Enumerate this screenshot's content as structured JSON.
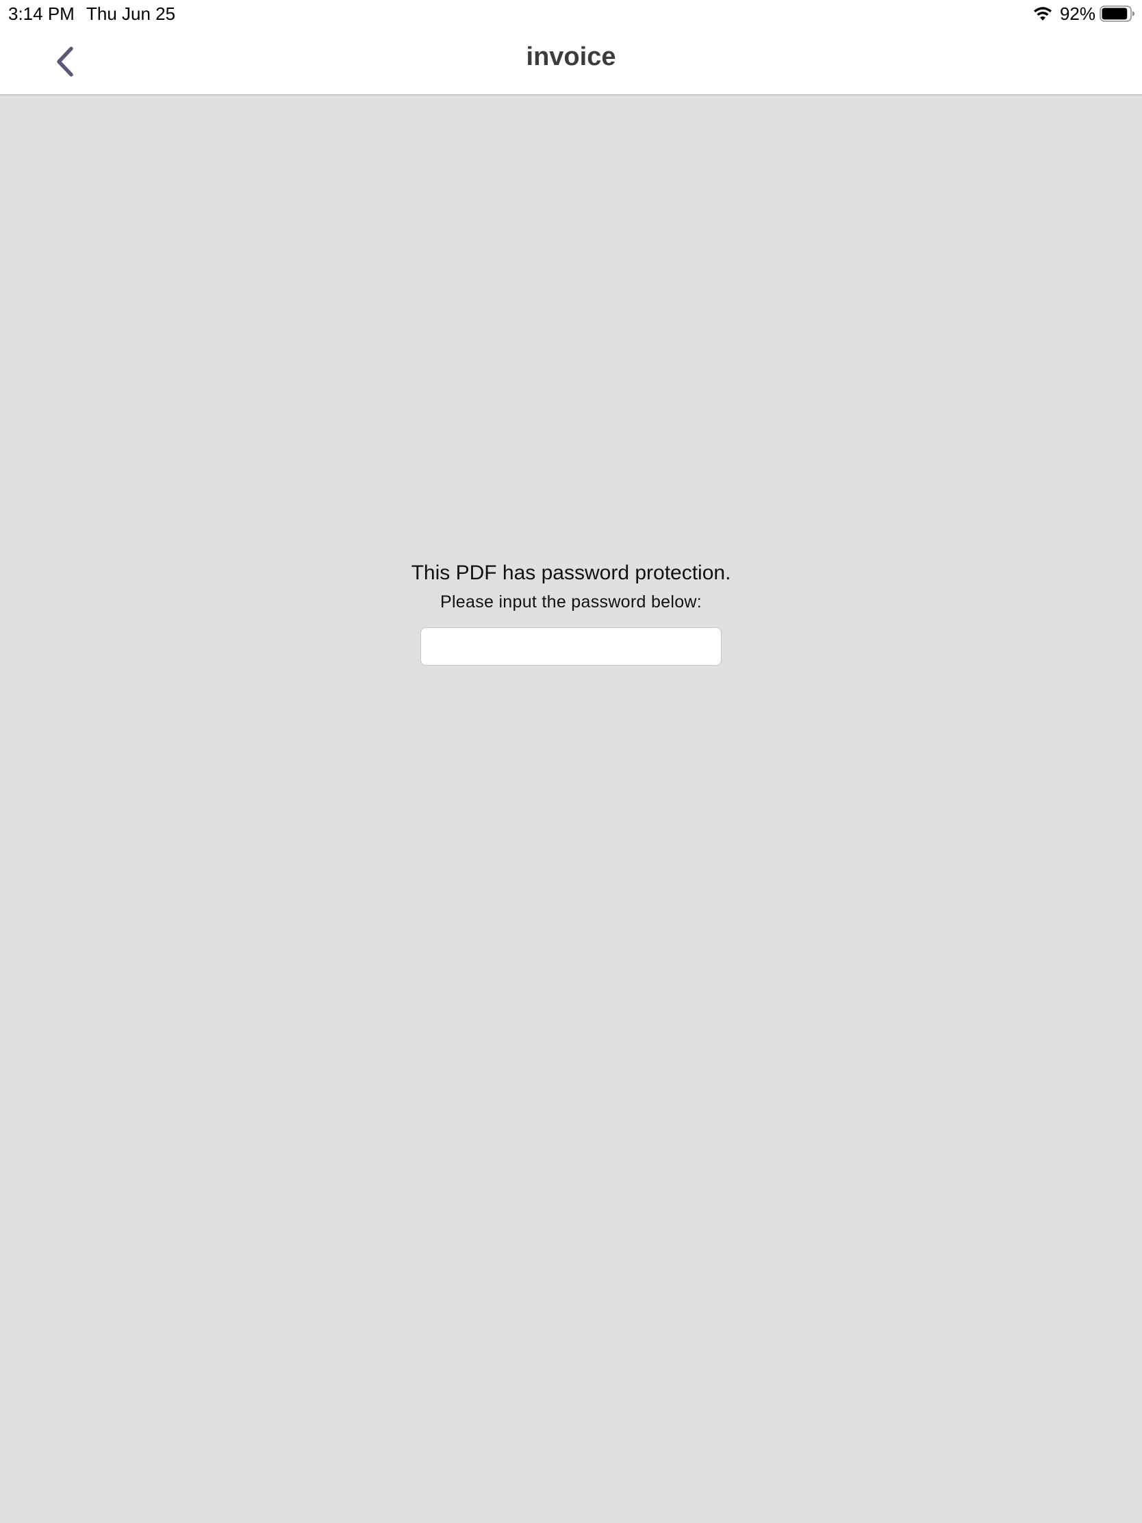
{
  "status_bar": {
    "time": "3:14 PM",
    "date": "Thu Jun 25",
    "battery_percent": "92%",
    "battery_level": 0.92,
    "icons": [
      "wifi-icon",
      "battery-icon"
    ]
  },
  "nav": {
    "title": "invoice",
    "back_icon": "chevron-left-icon",
    "accent_color": "#5a5a78"
  },
  "password_prompt": {
    "heading": "This PDF has password protection.",
    "subheading": "Please input the password below:",
    "input_value": "",
    "input_placeholder": ""
  },
  "colors": {
    "background": "#e0e0e0",
    "bar_background": "#ffffff"
  }
}
